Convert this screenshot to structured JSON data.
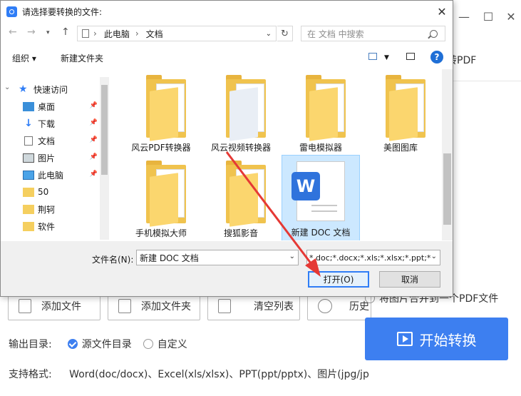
{
  "dialog": {
    "title": "请选择要转换的文件:",
    "address": {
      "crumb1": "此电脑",
      "crumb2": "文档"
    },
    "search_placeholder": "在 文档 中搜索",
    "toolbar": {
      "organize": "组织 ▾",
      "new_folder": "新建文件夹"
    },
    "tree": [
      {
        "label": "快速访问",
        "icon": "star-icon",
        "pinned": false
      },
      {
        "label": "桌面",
        "icon": "desktop-icon",
        "pinned": true
      },
      {
        "label": "下载",
        "icon": "download-icon",
        "pinned": true
      },
      {
        "label": "文档",
        "icon": "document-icon",
        "pinned": true
      },
      {
        "label": "图片",
        "icon": "picture-icon",
        "pinned": true
      },
      {
        "label": "此电脑",
        "icon": "computer-icon",
        "pinned": true
      },
      {
        "label": "50",
        "icon": "folder-icon",
        "pinned": false
      },
      {
        "label": "荆轲",
        "icon": "folder-icon",
        "pinned": false
      },
      {
        "label": "软件",
        "icon": "folder-icon",
        "pinned": false
      }
    ],
    "files": [
      {
        "label": "风云PDF转换器",
        "type": "folder"
      },
      {
        "label": "风云视频转换器",
        "type": "folder"
      },
      {
        "label": "雷电模拟器",
        "type": "folder"
      },
      {
        "label": "美图图库",
        "type": "folder"
      },
      {
        "label": "手机模拟大师",
        "type": "folder"
      },
      {
        "label": "搜狐影音",
        "type": "folder"
      },
      {
        "label": "新建 DOC 文档",
        "type": "doc",
        "selected": true
      }
    ],
    "filename_label": "文件名(N):",
    "filename_value": "新建 DOC 文档",
    "filter_value": "*.doc;*.docx;*.xls;*.xlsx;*.ppt;*",
    "open_label": "打开(O)",
    "cancel_label": "取消"
  },
  "app": {
    "pdf_label": "转PDF",
    "buttons": {
      "add_file": "添加文件",
      "add_folder": "添加文件夹",
      "clear_list": "清空列表",
      "history": "历史"
    },
    "merge_option": "将图片合并到一个PDF文件",
    "start_label": "开始转换",
    "output_label": "输出目录:",
    "output_source": "源文件目录",
    "output_custom": "自定义",
    "formats_label": "支持格式:",
    "formats_value": "Word(doc/docx)、Excel(xls/xlsx)、PPT(ppt/pptx)、图片(jpg/jp"
  },
  "colors": {
    "accent": "#3d7ff0",
    "arrow": "#e53935",
    "selection": "#cce8ff"
  }
}
